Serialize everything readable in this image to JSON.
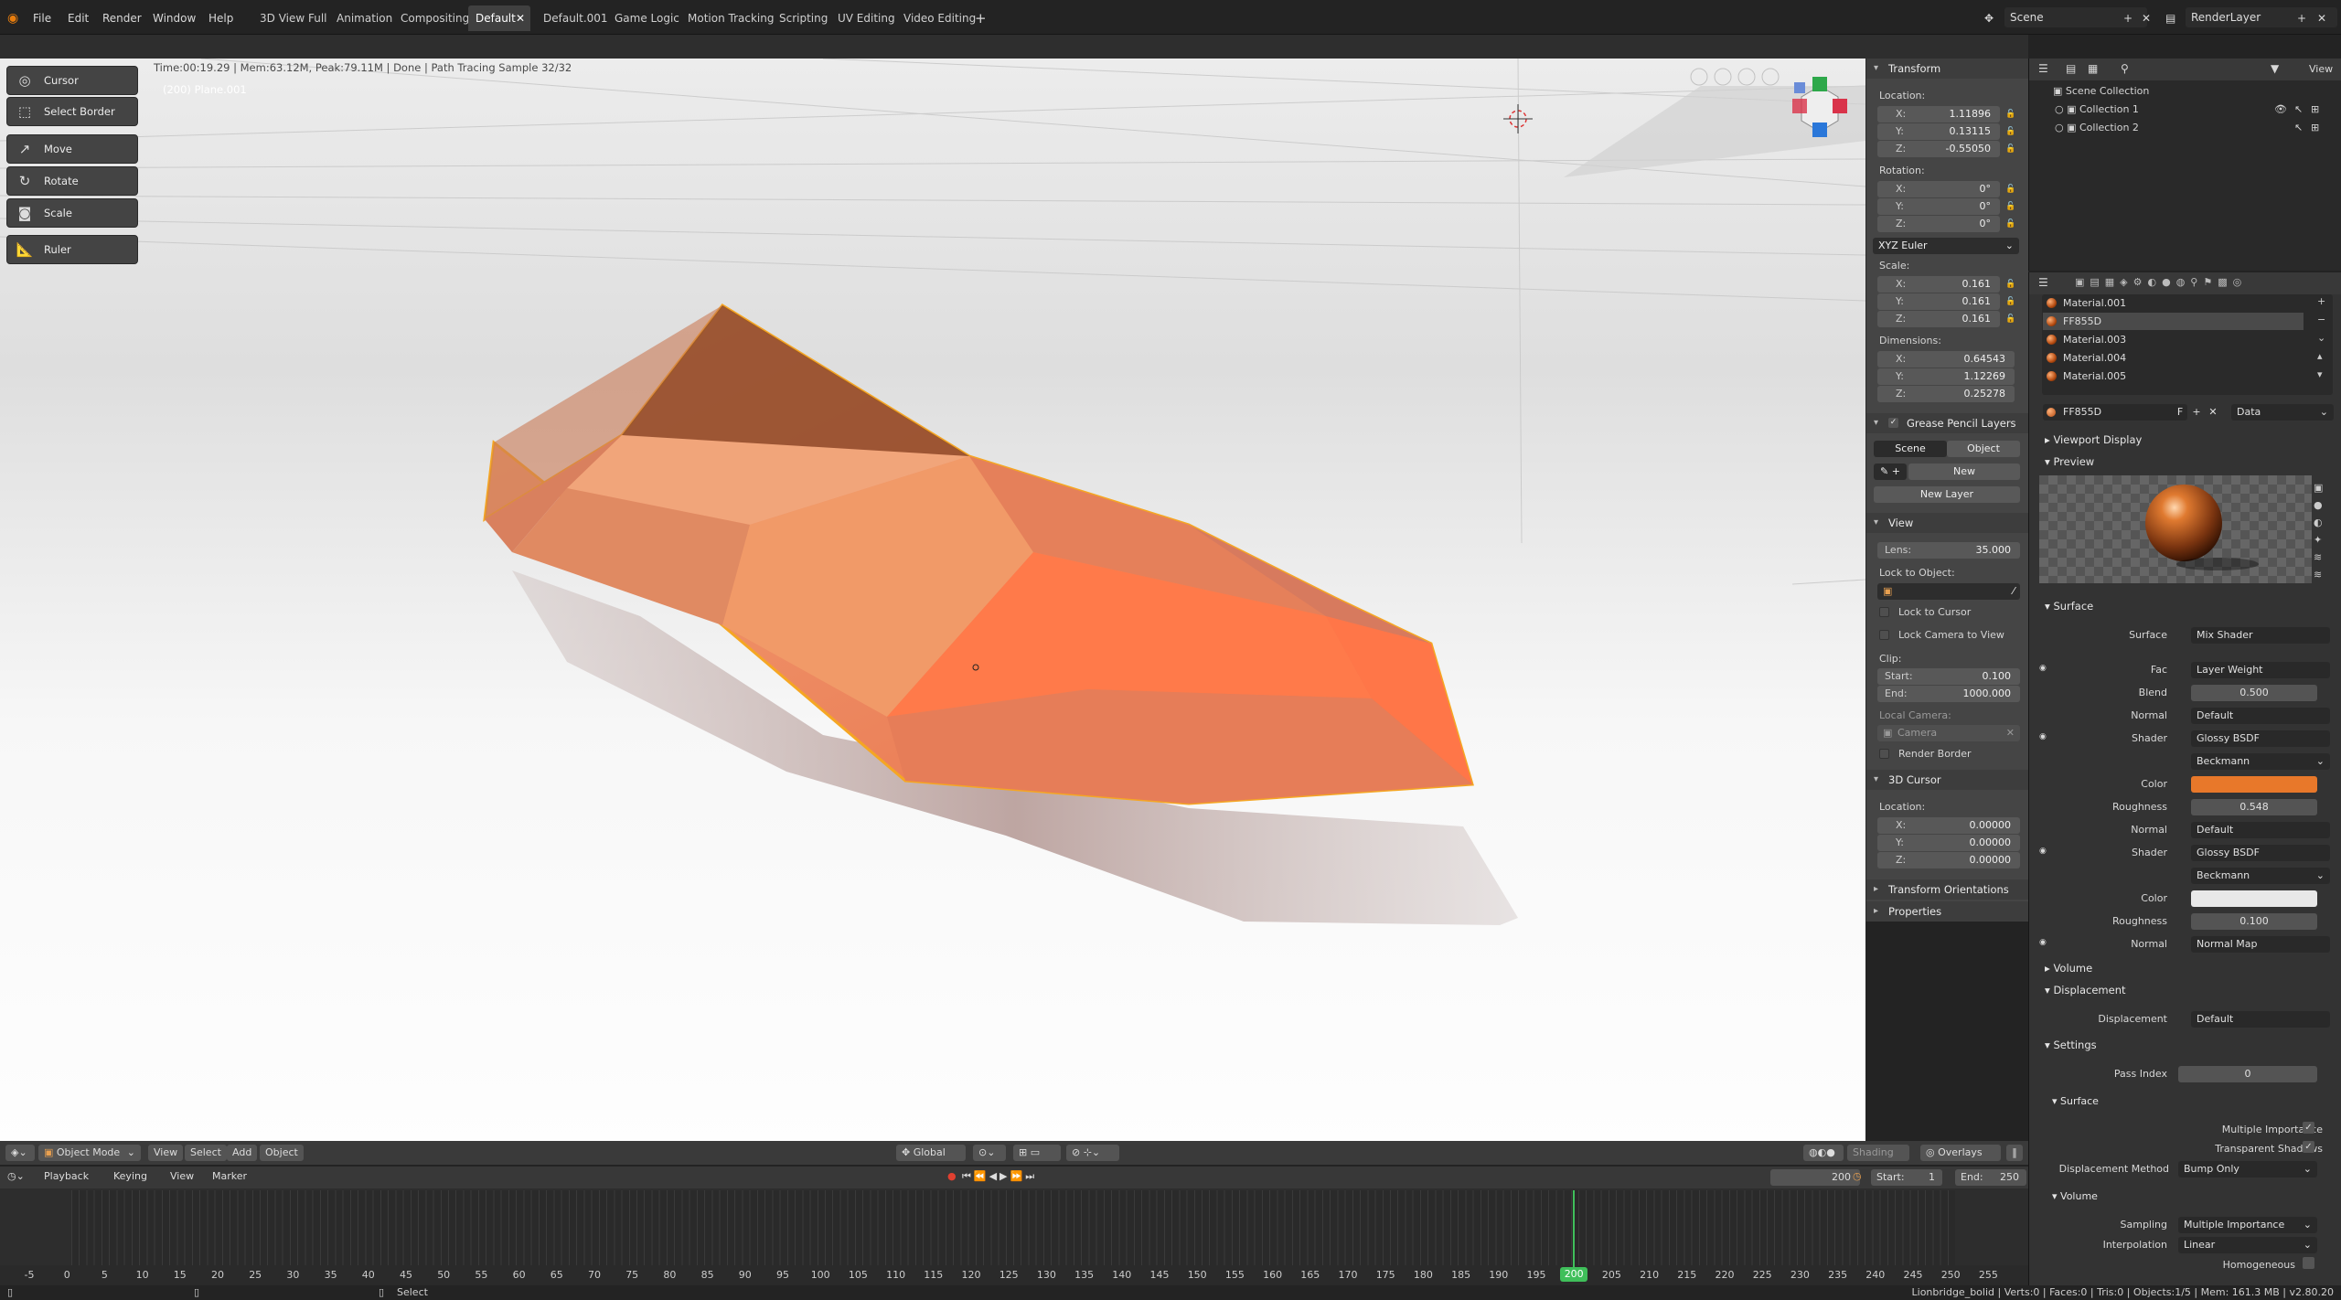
{
  "topbar": {
    "menus": [
      "File",
      "Edit",
      "Render",
      "Window",
      "Help"
    ],
    "workspaces": [
      "3D View Full",
      "Animation",
      "Compositing",
      "Default",
      "Default.001",
      "Game Logic",
      "Motion Tracking",
      "Scripting",
      "UV Editing",
      "Video Editing"
    ],
    "active_workspace": "Default",
    "scene": "Scene",
    "render_layer": "RenderLayer"
  },
  "viewport": {
    "info": "Time:00:19.29 | Mem:63.12M, Peak:79.11M | Done | Path Tracing Sample 32/32",
    "object_label": "(200) Plane.001",
    "tools": [
      "Cursor",
      "Select Border",
      "Move",
      "Rotate",
      "Scale",
      "Ruler"
    ],
    "object_color": "#e8794f",
    "outline_color": "#f5a623"
  },
  "npanel": {
    "transform": {
      "title": "Transform",
      "location_label": "Location:",
      "location": {
        "x": "1.11896",
        "y": "0.13115",
        "z": "-0.55050"
      },
      "rotation_label": "Rotation:",
      "rotation": {
        "x": "0°",
        "y": "0°",
        "z": "0°"
      },
      "rotation_mode": "XYZ Euler",
      "scale_label": "Scale:",
      "scale": {
        "x": "0.161",
        "y": "0.161",
        "z": "0.161"
      },
      "dimensions_label": "Dimensions:",
      "dimensions": {
        "x": "0.64543",
        "y": "1.12269",
        "z": "0.25278"
      },
      "x": "X:",
      "y": "Y:",
      "z": "Z:"
    },
    "grease_pencil": {
      "title": "Grease Pencil Layers",
      "scene_tab": "Scene",
      "object_tab": "Object",
      "new": "New",
      "new_layer": "New Layer"
    },
    "view": {
      "title": "View",
      "lens_label": "Lens:",
      "lens": "35.000",
      "lock_to_object": "Lock to Object:",
      "lock_to_cursor": "Lock to Cursor",
      "lock_camera": "Lock Camera to View",
      "clip": "Clip:",
      "clip_start_label": "Start:",
      "clip_start": "0.100",
      "clip_end_label": "End:",
      "clip_end": "1000.000",
      "local_camera": "Local Camera:",
      "camera_placeholder": "Camera",
      "render_border": "Render Border"
    },
    "cursor": {
      "title": "3D Cursor",
      "location_label": "Location:",
      "location": {
        "x": "0.00000",
        "y": "0.00000",
        "z": "0.00000"
      }
    },
    "transform_orientations": "Transform Orientations",
    "properties": "Properties"
  },
  "outliner": {
    "view_label": "View",
    "scene_collection": "Scene Collection",
    "collections": [
      "Collection 1",
      "Collection 2"
    ]
  },
  "properties": {
    "materials": [
      "Material.001",
      "FF855D",
      "Material.003",
      "Material.004",
      "Material.005"
    ],
    "active_material": "FF855D",
    "material_name": "FF855D",
    "fake_user": "F",
    "link": "Data",
    "viewport_display": "Viewport Display",
    "preview": "Preview",
    "surface_section": "Surface",
    "rows": [
      {
        "label": "Surface",
        "value": "Mix Shader"
      },
      {
        "label": "Fac",
        "value": "Layer Weight"
      },
      {
        "label": "Blend",
        "value": "0.500"
      },
      {
        "label": "Normal",
        "value": "Default"
      },
      {
        "label": "Shader",
        "value": "Glossy BSDF"
      },
      {
        "label": "",
        "value": "Beckmann"
      },
      {
        "label": "Color",
        "value": ""
      },
      {
        "label": "Roughness",
        "value": "0.548"
      },
      {
        "label": "Normal",
        "value": "Default"
      },
      {
        "label": "Shader",
        "value": "Glossy BSDF"
      },
      {
        "label": "",
        "value": "Beckmann"
      },
      {
        "label": "Color",
        "value": ""
      },
      {
        "label": "Roughness",
        "value": "0.100"
      },
      {
        "label": "Normal",
        "value": "Normal Map"
      }
    ],
    "color1": "#e8782a",
    "color2": "#e8e8e8",
    "volume": "Volume",
    "displacement": "Displacement",
    "displacement_label": "Displacement",
    "displacement_value": "Default",
    "settings": "Settings",
    "pass_index_label": "Pass Index",
    "pass_index": "0",
    "settings_surface": "Surface",
    "multiple_importance": "Multiple Importance",
    "transparent_shadows": "Transparent Shadows",
    "displacement_method_label": "Displacement Method",
    "displacement_method": "Bump Only",
    "settings_volume": "Volume",
    "sampling_label": "Sampling",
    "sampling": "Multiple Importance",
    "interpolation_label": "Interpolation",
    "interpolation": "Linear",
    "homogeneous": "Homogeneous"
  },
  "viewport_header": {
    "mode": "Object Mode",
    "menus": [
      "View",
      "Select",
      "Add",
      "Object"
    ],
    "orientation": "Global",
    "shading": "Shading",
    "overlays": "Overlays"
  },
  "timeline": {
    "menus": [
      "Playback",
      "Keying",
      "View",
      "Marker"
    ],
    "current_frame": "200",
    "start_label": "Start:",
    "start": "1",
    "end_label": "End:",
    "end": "250",
    "ticks": [
      "-5",
      "0",
      "5",
      "10",
      "15",
      "20",
      "25",
      "30",
      "35",
      "40",
      "45",
      "50",
      "55",
      "60",
      "65",
      "70",
      "75",
      "80",
      "85",
      "90",
      "95",
      "100",
      "105",
      "110",
      "115",
      "120",
      "125",
      "130",
      "135",
      "140",
      "145",
      "150",
      "155",
      "160",
      "165",
      "170",
      "175",
      "180",
      "185",
      "190",
      "195",
      "200",
      "205",
      "210",
      "215",
      "220",
      "225",
      "230",
      "235",
      "240",
      "245",
      "250",
      "255"
    ],
    "playhead_color": "#3fbf5a"
  },
  "statusbar": {
    "select": "Select",
    "stats": "Lionbridge_bolid | Verts:0 | Faces:0 | Tris:0 | Objects:1/5 | Mem: 161.3 MB | v2.80.20"
  }
}
